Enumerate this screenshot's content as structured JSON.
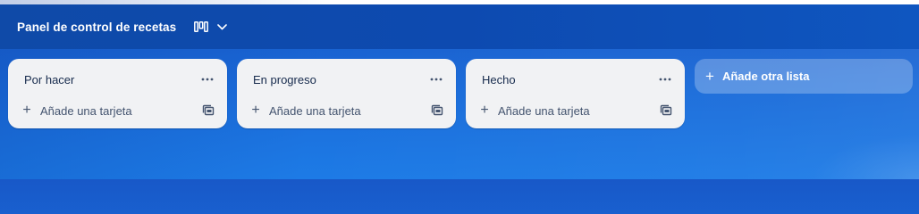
{
  "board": {
    "title": "Panel de control de recetas",
    "view_icon": "board-view-icon",
    "dropdown_icon": "chevron-down-icon"
  },
  "lists": [
    {
      "title": "Por hacer",
      "add_card_label": "Añade una tarjeta"
    },
    {
      "title": "En progreso",
      "add_card_label": "Añade una tarjeta"
    },
    {
      "title": "Hecho",
      "add_card_label": "Añade una tarjeta"
    }
  ],
  "add_list": {
    "label": "Añade otra lista"
  },
  "colors": {
    "header_bg": "#0f4aa8",
    "board_bg": "#1a6ad8",
    "list_bg": "#f1f2f4",
    "list_text": "#172b4d"
  }
}
